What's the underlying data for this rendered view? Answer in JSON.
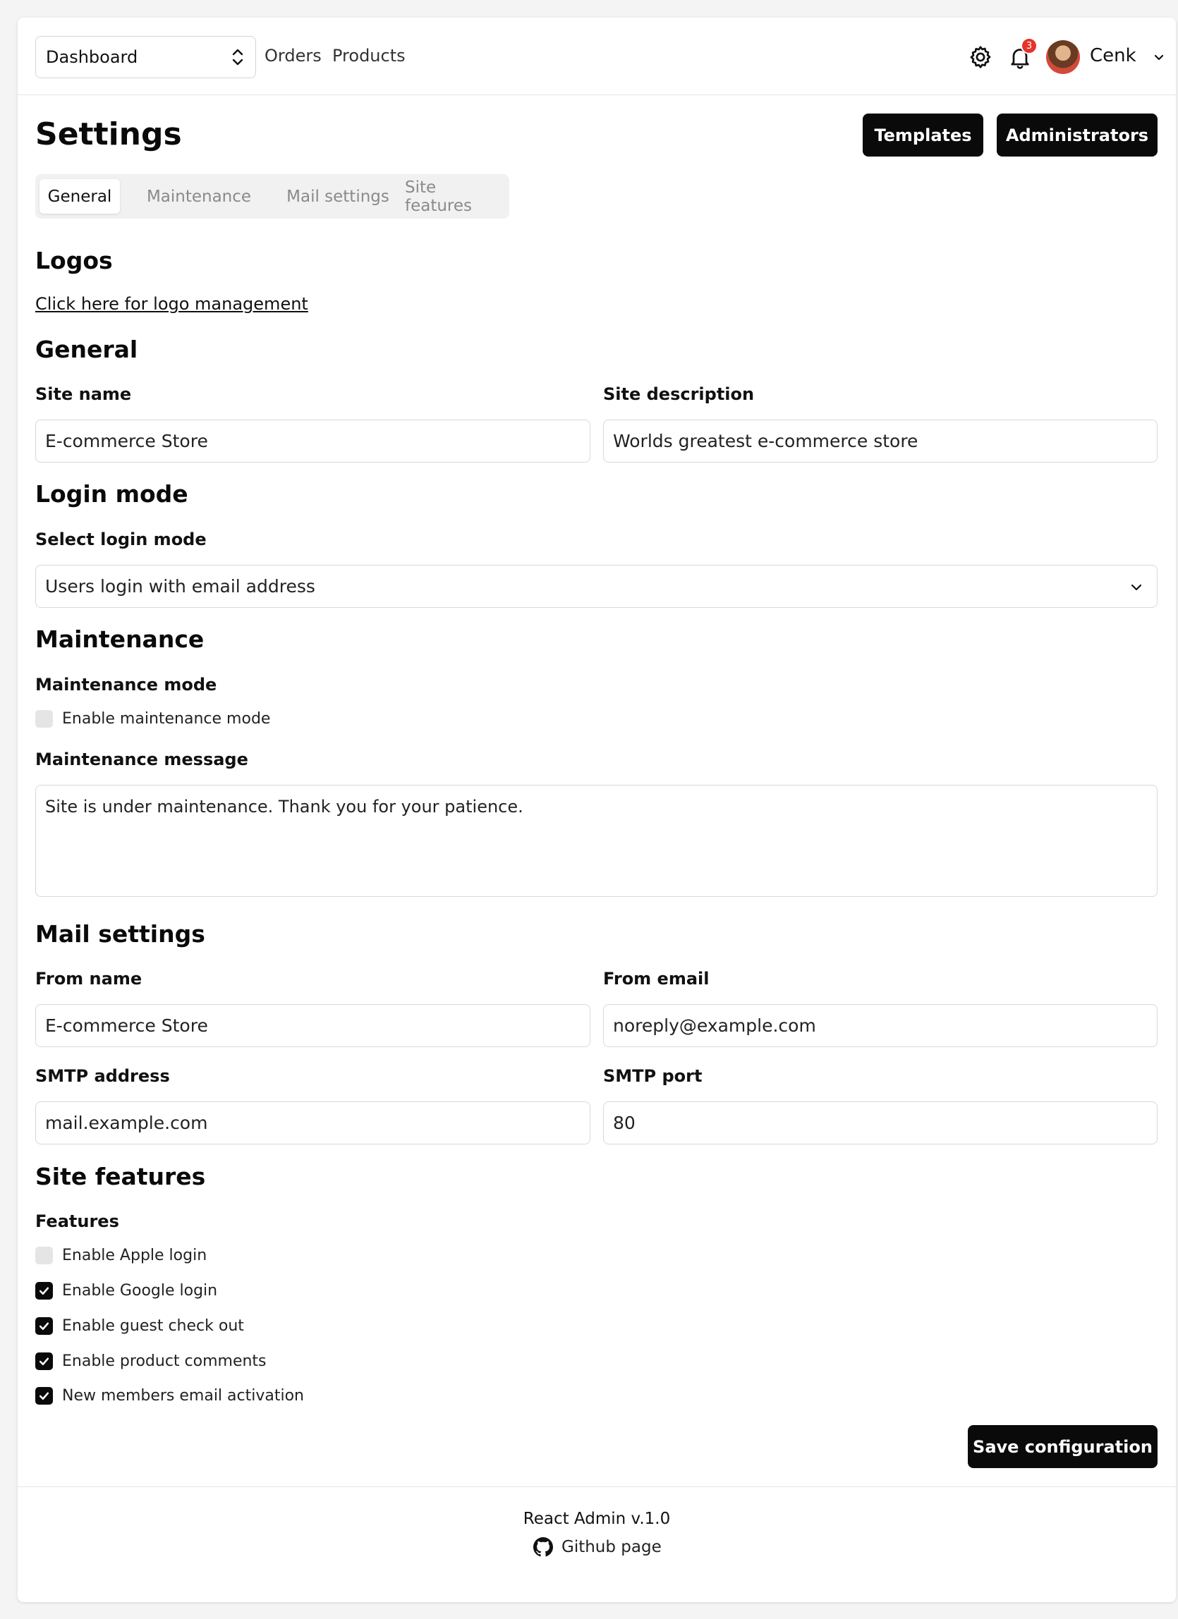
{
  "header": {
    "nav_select": "Dashboard",
    "links": [
      "Orders",
      "Products"
    ],
    "notification_count": "3",
    "user_name": "Cenk",
    "icons": [
      "gear-icon",
      "bell-icon",
      "chevron-down-icon"
    ]
  },
  "page": {
    "title": "Settings",
    "buttons": {
      "templates": "Templates",
      "administrators": "Administrators"
    },
    "tabs": [
      "General",
      "Maintenance",
      "Mail settings",
      "Site features"
    ],
    "active_tab": "General"
  },
  "logos": {
    "heading": "Logos",
    "link": "Click here for logo management"
  },
  "general": {
    "heading": "General",
    "site_name_label": "Site name",
    "site_name": "E-commerce Store",
    "site_description_label": "Site description",
    "site_description": "Worlds greatest e-commerce store"
  },
  "login": {
    "heading": "Login mode",
    "label": "Select login mode",
    "value": "Users login with email address"
  },
  "maintenance": {
    "heading": "Maintenance",
    "mode_label": "Maintenance mode",
    "checkbox_label": "Enable maintenance mode",
    "enabled": false,
    "message_label": "Maintenance message",
    "message": "Site is under maintenance. Thank you for your patience."
  },
  "mail": {
    "heading": "Mail settings",
    "from_name_label": "From name",
    "from_name": "E-commerce Store",
    "from_email_label": "From email",
    "from_email": "noreply@example.com",
    "smtp_address_label": "SMTP address",
    "smtp_address": "mail.example.com",
    "smtp_port_label": "SMTP port",
    "smtp_port": "80"
  },
  "features": {
    "heading": "Site features",
    "label": "Features",
    "items": [
      {
        "label": "Enable Apple login",
        "checked": false
      },
      {
        "label": "Enable Google login",
        "checked": true
      },
      {
        "label": "Enable guest check out",
        "checked": true
      },
      {
        "label": "Enable product comments",
        "checked": true
      },
      {
        "label": "New members email activation",
        "checked": true
      }
    ]
  },
  "save_label": "Save configuration",
  "footer": {
    "version": "React Admin v.1.0",
    "github": "Github page"
  },
  "colors": {
    "primary": "#0a0a0a",
    "badge": "#e5342b",
    "border": "#d8d8d8"
  }
}
